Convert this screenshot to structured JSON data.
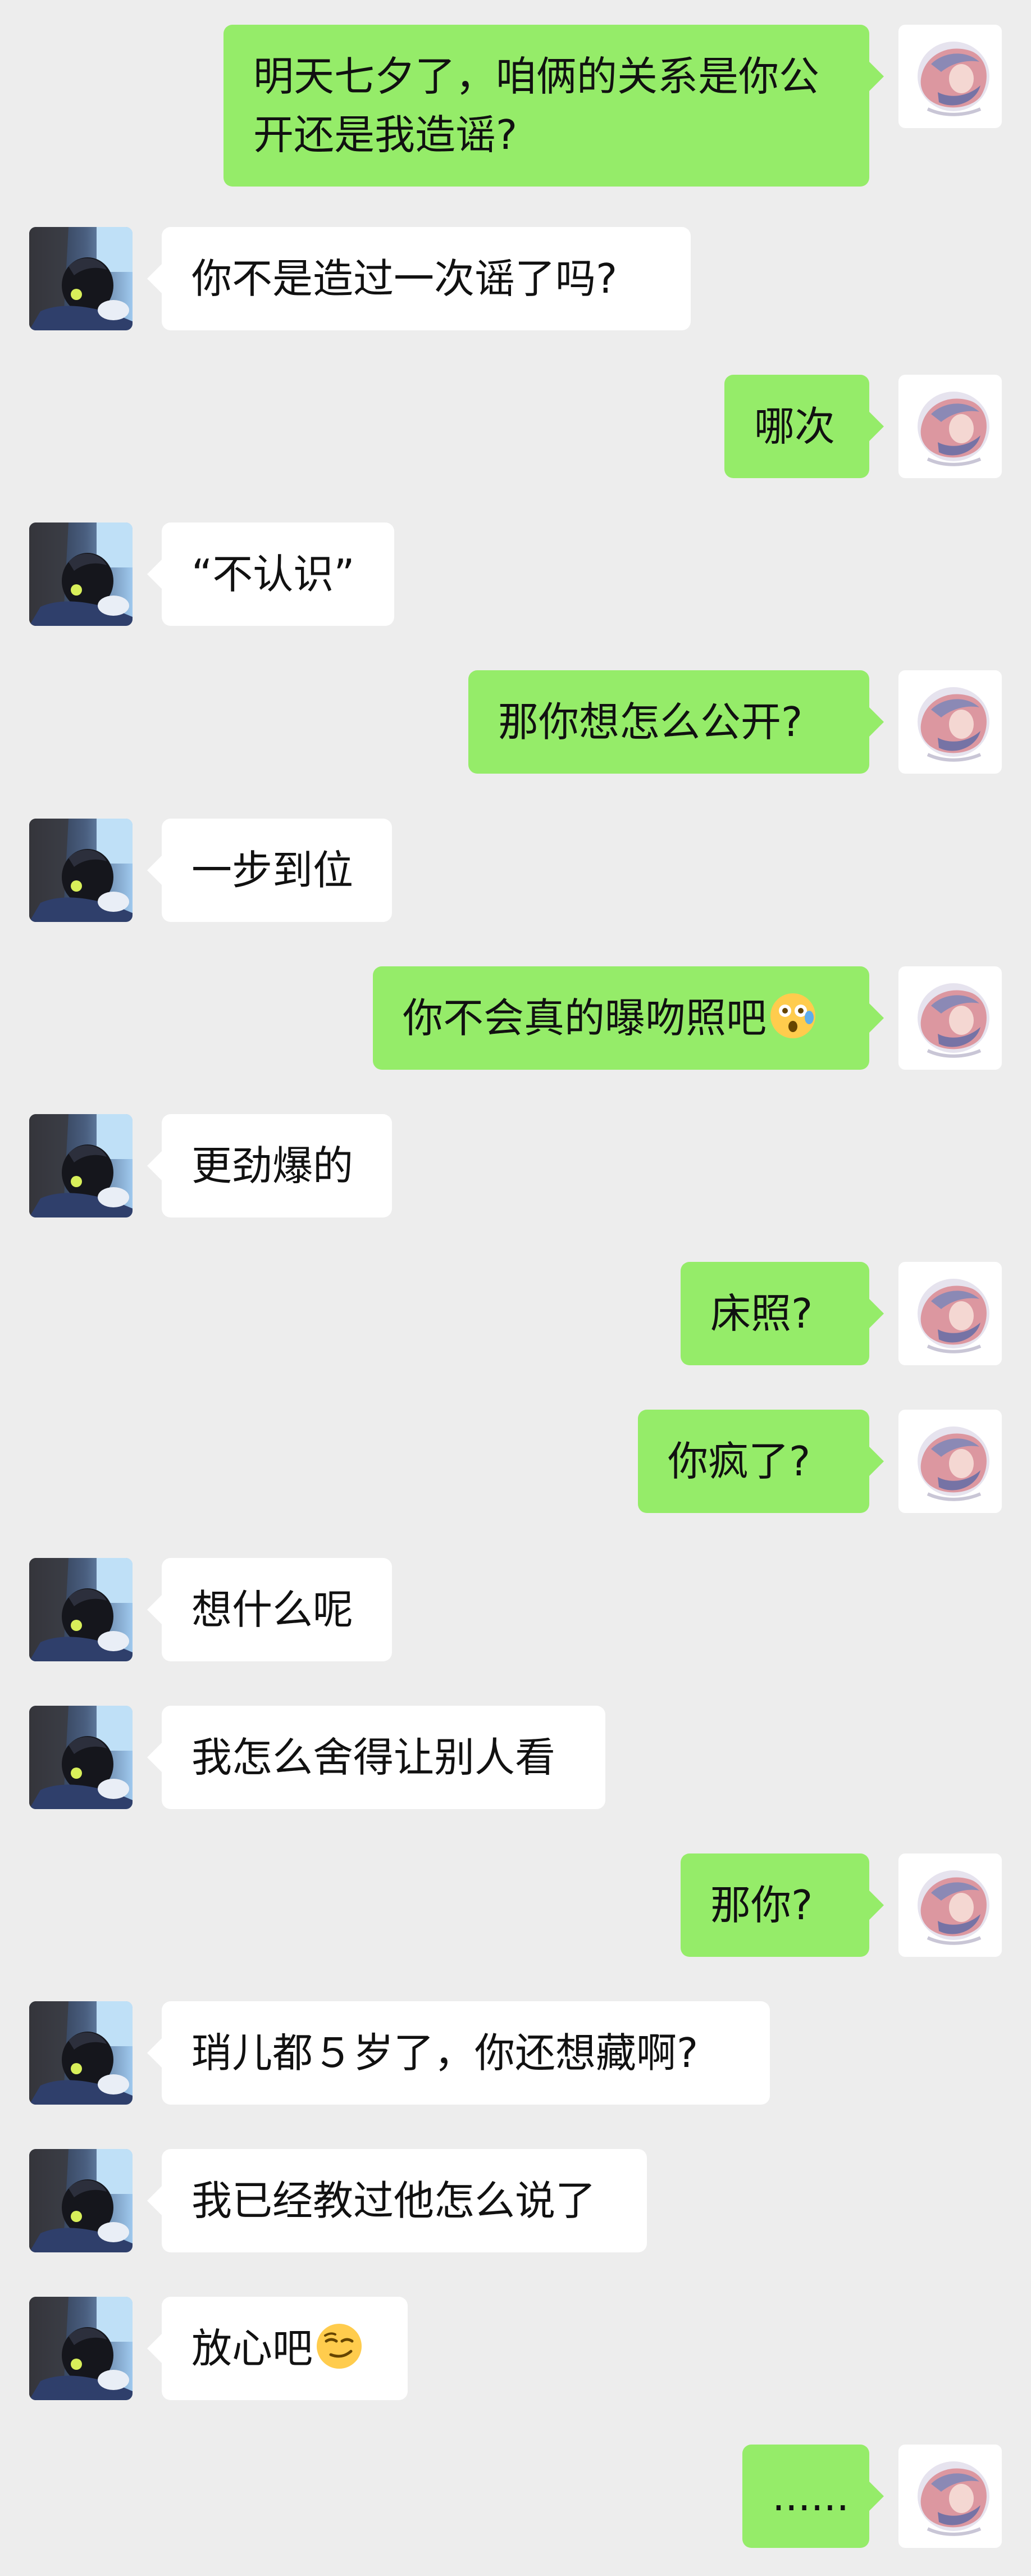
{
  "conversation": {
    "messages": [
      {
        "side": "right",
        "text": "明天七夕了，咱俩的关系是你公\n开还是我造谣?",
        "emoji": ""
      },
      {
        "side": "left",
        "text": "你不是造过一次谣了吗?",
        "emoji": ""
      },
      {
        "side": "right",
        "text": "哪次",
        "emoji": ""
      },
      {
        "side": "left",
        "text": "“不认识”",
        "emoji": ""
      },
      {
        "side": "right",
        "text": "那你想怎么公开?",
        "emoji": ""
      },
      {
        "side": "left",
        "text": "一步到位",
        "emoji": ""
      },
      {
        "side": "right",
        "text": "你不会真的曝吻照吧",
        "emoji": "astonished-face-emoji"
      },
      {
        "side": "left",
        "text": "更劲爆的",
        "emoji": ""
      },
      {
        "side": "right",
        "text": "床照?",
        "emoji": ""
      },
      {
        "side": "right",
        "text": "你疯了?",
        "emoji": ""
      },
      {
        "side": "left",
        "text": "想什么呢",
        "emoji": ""
      },
      {
        "side": "left",
        "text": "我怎么舍得让别人看",
        "emoji": ""
      },
      {
        "side": "right",
        "text": "那你?",
        "emoji": ""
      },
      {
        "side": "left",
        "text": "琑儿都５岁了，你还想藏啊?",
        "emoji": ""
      },
      {
        "side": "left",
        "text": "我已经教过他怎么说了",
        "emoji": ""
      },
      {
        "side": "left",
        "text": "放心吧",
        "emoji": "smirking-face-emoji"
      },
      {
        "side": "right",
        "text": "......",
        "emoji": ""
      }
    ]
  },
  "colors": {
    "background": "#ededed",
    "sent_bubble": "#95ec69",
    "received_bubble": "#ffffff",
    "text": "#111111"
  },
  "icons": {
    "self_avatar": "anime-girl-avatar",
    "contact_avatar": "character-photo-avatar"
  }
}
